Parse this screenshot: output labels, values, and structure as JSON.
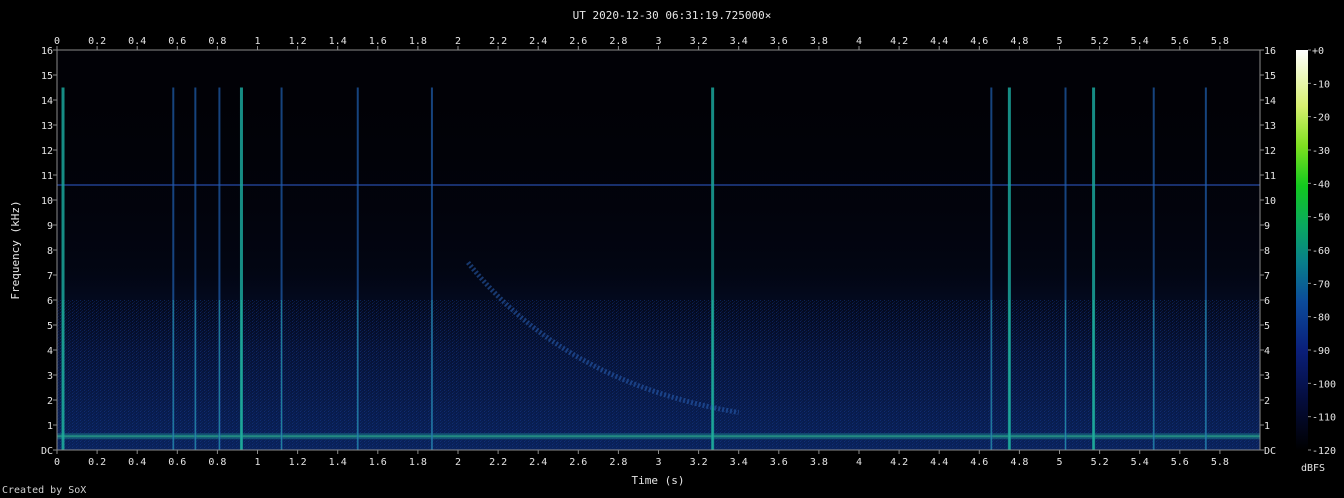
{
  "chart_data": {
    "type": "heatmap",
    "title": "UT 2020-12-30 06:31:19.725000×",
    "xlabel": "Time (s)",
    "ylabel": "Frequency (kHz)",
    "xlim": [
      0,
      6
    ],
    "ylim": [
      0,
      16
    ],
    "x_ticks": [
      "0",
      "0.2",
      "0.4",
      "0.6",
      "0.8",
      "1",
      "1.2",
      "1.4",
      "1.6",
      "1.8",
      "2",
      "2.2",
      "2.4",
      "2.6",
      "2.8",
      "3",
      "3.2",
      "3.4",
      "3.6",
      "3.8",
      "4",
      "4.2",
      "4.4",
      "4.6",
      "4.8",
      "5",
      "5.2",
      "5.4",
      "5.6",
      "5.8"
    ],
    "y_ticks": [
      "DC",
      "1",
      "2",
      "3",
      "4",
      "5",
      "6",
      "7",
      "8",
      "9",
      "10",
      "11",
      "12",
      "13",
      "14",
      "15",
      "16"
    ],
    "colorbar": {
      "label": "dBFS",
      "ticks": [
        "+0",
        "-10",
        "-20",
        "-30",
        "-40",
        "-50",
        "-60",
        "-70",
        "-80",
        "-90",
        "-100",
        "-110",
        "-120"
      ],
      "range": [
        -120,
        0
      ]
    },
    "features": {
      "hum_line_khz": 10.6,
      "low_band_khz": 0.55,
      "impulses_s": [
        0.03,
        0.58,
        0.69,
        0.81,
        0.92,
        1.12,
        1.5,
        1.87,
        3.27,
        4.66,
        4.75,
        5.03,
        5.17,
        5.47,
        5.73
      ],
      "whistler_sweep": {
        "t_start_s": 2.05,
        "t_end_s": 3.4,
        "f_start_khz": 7.5,
        "f_end_khz": 1.5
      }
    }
  },
  "credit": "Created by SoX"
}
